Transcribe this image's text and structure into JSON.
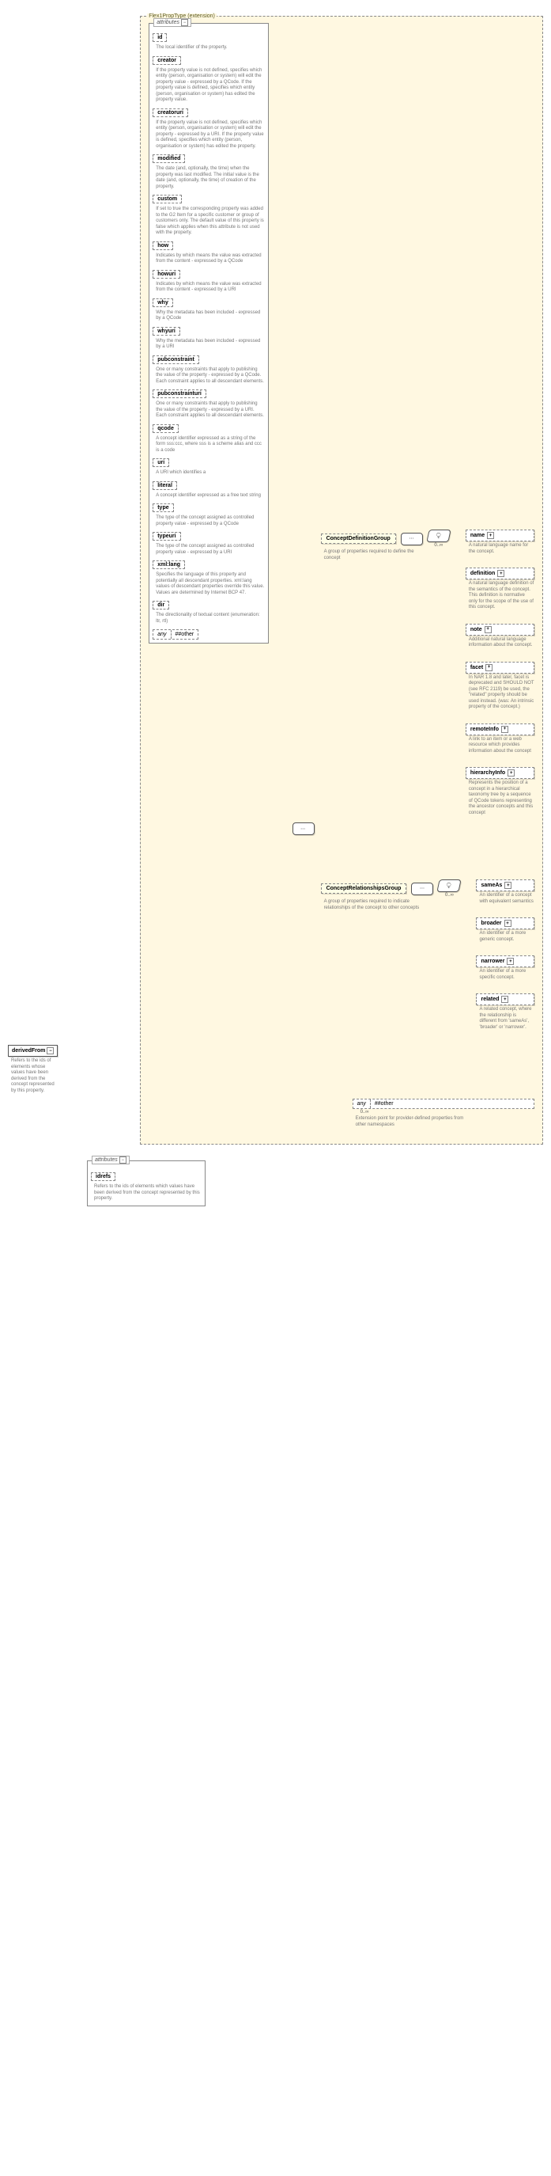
{
  "extension": {
    "label": "Flex1PropType (extension)"
  },
  "root": {
    "name": "derivedFrom",
    "doc": "Refers to the ids of elements whose values have been derived from the concept represented by this property."
  },
  "attr_group_label": "attributes",
  "attributes": [
    {
      "name": "id",
      "doc": "The local identifier of the property."
    },
    {
      "name": "creator",
      "doc": "If the property value is not defined, specifies which entity (person, organisation or system) will edit the property value - expressed by a QCode. If the property value is defined, specifies which entity (person, organisation or system) has edited the property value."
    },
    {
      "name": "creatoruri",
      "doc": "If the property value is not defined, specifies which entity (person, organisation or system) will edit the property - expressed by a URI. If the property value is defined, specifies which entity (person, organisation or system) has edited the property."
    },
    {
      "name": "modified",
      "doc": "The date (and, optionally, the time) when the property was last modified. The initial value is the date (and, optionally, the time) of creation of the property."
    },
    {
      "name": "custom",
      "doc": "If set to true the corresponding property was added to the G2 Item for a specific customer or group of customers only. The default value of this property is false which applies when this attribute is not used with the property."
    },
    {
      "name": "how",
      "doc": "Indicates by which means the value was extracted from the content - expressed by a QCode"
    },
    {
      "name": "howuri",
      "doc": "Indicates by which means the value was extracted from the content - expressed by a URI"
    },
    {
      "name": "why",
      "doc": "Why the metadata has been included - expressed by a QCode"
    },
    {
      "name": "whyuri",
      "doc": "Why the metadata has been included - expressed by a URI"
    },
    {
      "name": "pubconstraint",
      "doc": "One or many constraints that apply to publishing the value of the property - expressed by a QCode. Each constraint applies to all descendant elements."
    },
    {
      "name": "pubconstrainturi",
      "doc": "One or many constraints that apply to publishing the value of the property - expressed by a URI. Each constraint applies to all descendant elements."
    },
    {
      "name": "qcode",
      "doc": "A concept identifier expressed as a string of the form sss:ccc, where sss is a scheme alias and ccc is a code"
    },
    {
      "name": "uri",
      "doc": "A URI which identifies a"
    },
    {
      "name": "literal",
      "doc": "A concept identifier expressed as a free text string"
    },
    {
      "name": "type",
      "doc": "The type of the concept assigned as controlled property value - expressed by a QCode"
    },
    {
      "name": "typeuri",
      "doc": "The type of the concept assigned as controlled property value - expressed by a URI"
    },
    {
      "name": "xml:lang",
      "doc": "Specifies the language of this property and potentially all descendant properties. xml:lang values of descendant properties override this value. Values are determined by Internet BCP 47."
    },
    {
      "name": "dir",
      "doc": "The directionality of textual content (enumeration: ltr, rtl)"
    }
  ],
  "any_other": {
    "left": "any",
    "right": "##other"
  },
  "groups": {
    "def": {
      "name": "ConceptDefinitionGroup",
      "doc": "A group of properties required to define the concept",
      "occ": "0..∞",
      "children": [
        {
          "name": "name",
          "dashed": true,
          "plus": true,
          "doc": "A natural language name for the concept."
        },
        {
          "name": "definition",
          "dashed": true,
          "plus": true,
          "doc": "A natural language definition of the semantics of the concept. This definition is normative only for the scope of the use of this concept."
        },
        {
          "name": "note",
          "dashed": true,
          "plus": true,
          "doc": "Additional natural language information about the concept."
        },
        {
          "name": "facet",
          "dashed": true,
          "plus": true,
          "doc": "In NAR 1.8 and later, facet is deprecated and SHOULD NOT (see RFC 2119) be used, the \"related\" property should be used instead. (was: An intrinsic property of the concept.)"
        },
        {
          "name": "remoteInfo",
          "dashed": true,
          "plus": true,
          "doc": "A link to an item or a web resource which provides information about the concept"
        },
        {
          "name": "hierarchyInfo",
          "dashed": true,
          "plus": true,
          "doc": "Represents the position of a concept in a hierarchical taxonomy tree by a sequence of QCode tokens representing the ancestor concepts and this concept"
        }
      ]
    },
    "rel": {
      "name": "ConceptRelationshipsGroup",
      "doc": "A group of properties required to indicate relationships of the concept to other concepts",
      "occ": "0..∞",
      "children": [
        {
          "name": "sameAs",
          "dashed": true,
          "plus": true,
          "doc": "An identifier of a concept with equivalent semantics"
        },
        {
          "name": "broader",
          "dashed": true,
          "plus": true,
          "doc": "An identifier of a more generic concept."
        },
        {
          "name": "narrower",
          "dashed": true,
          "plus": true,
          "doc": "An identifier of a more specific concept."
        },
        {
          "name": "related",
          "dashed": true,
          "plus": true,
          "doc": "A related concept, where the relationship is different from 'sameAs', 'broader' or 'narrower'."
        }
      ]
    }
  },
  "bottom_any": {
    "left": "any",
    "right": "##other",
    "occ": "0..∞",
    "doc": "Extension point for provider-defined properties from other namespaces"
  },
  "bottom_attrs": {
    "label": "attributes",
    "item": {
      "name": "idrefs",
      "doc": "Refers to the ids of elements which values have been derived from the concept represented by this property."
    }
  }
}
